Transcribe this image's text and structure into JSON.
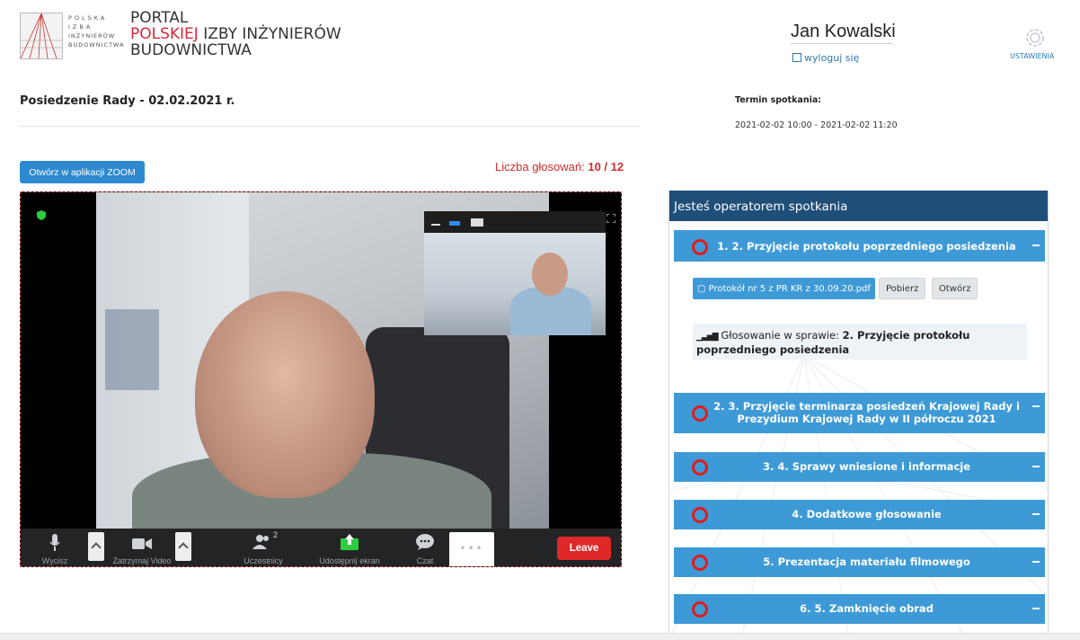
{
  "logo": {
    "line1": "POLSKA",
    "line2": "IZBA",
    "line3": "INŻYNIERÓW",
    "line4": "BUDOWNICTWA"
  },
  "portal": {
    "line1": "PORTAL",
    "line2_red": "POLSKIEJ",
    "line2_rest": " IZBY INŻYNIERÓW",
    "line3": "BUDOWNICTWA"
  },
  "user": {
    "name": "Jan Kowalski",
    "logout": "wyloguj się",
    "settings": "USTAWIENIA"
  },
  "meeting": {
    "title": "Posiedzenie Rady - 02.02.2021 r.",
    "term_label": "Termin spotkania:",
    "term_value": "2021-02-02 10:00 - 2021-02-02 11:20",
    "zoom_button": "Otwórz w aplikacji ZOOM",
    "votes_label": "Liczba głosowań:",
    "votes_value": "10 / 12"
  },
  "zoom_toolbar": {
    "mute": "Wycisz",
    "stop_video": "Zatrzymaj Video",
    "participants": "Uczestnicy",
    "participants_count": "2",
    "share": "Udostępnij ekran",
    "chat": "Czat",
    "more": "•••",
    "leave": "Leave"
  },
  "agenda": {
    "header": "Jesteś operatorem spotkania",
    "items": [
      {
        "label": "1. 2. Przyjęcie protokołu poprzedniego posiedzenia"
      },
      {
        "label": "2. 3. Przyjęcie terminarza posiedzeń Krajowej Rady i Prezydium Krajowej Rady w II półroczu 2021"
      },
      {
        "label": "3. 4. Sprawy wniesione i informacje"
      },
      {
        "label": "4. Dodatkowe głosowanie"
      },
      {
        "label": "5. Prezentacja materiału filmowego"
      },
      {
        "label": "6. 5. Zamknięcie obrad"
      }
    ],
    "file": "Protokół nr 5 z PR KR z 30.09.20.pdf",
    "download": "Pobierz",
    "open": "Otwórz",
    "vote_prefix": "Głosowanie w sprawie: ",
    "vote_subject": "2. Przyjęcie protokołu poprzedniego posiedzenia"
  },
  "colors": {
    "accent_blue": "#3d9ad6",
    "header_navy": "#1f4e78",
    "alert_red": "#d02d2d",
    "leave_red": "#e02828"
  }
}
